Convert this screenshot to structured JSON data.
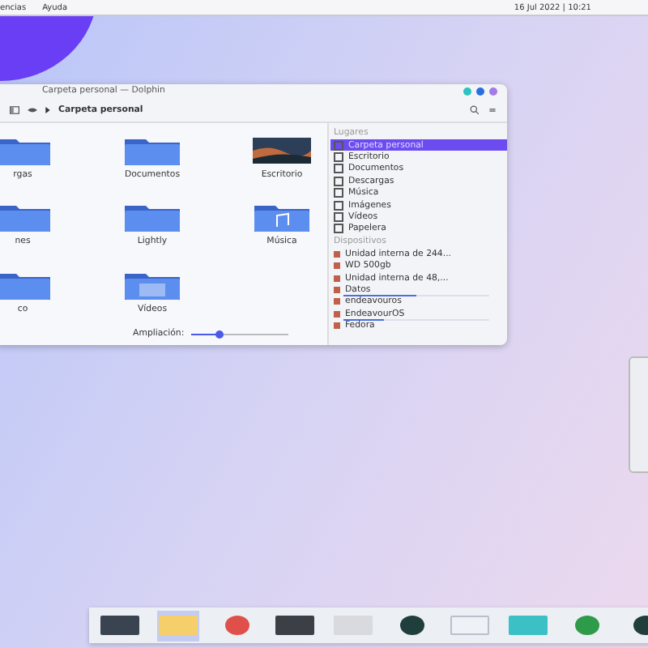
{
  "top_bar": {
    "menus": [
      "encias",
      "Ayuda"
    ],
    "clock": "16 Jul 2022 | 10:21"
  },
  "window": {
    "title": "Carpeta personal — Dolphin",
    "breadcrumb": "Carpeta personal",
    "files": [
      {
        "name": "rgas",
        "kind": "folder"
      },
      {
        "name": "Documentos",
        "kind": "folder"
      },
      {
        "name": "Escritorio",
        "kind": "image"
      },
      {
        "name": "nes",
        "kind": "folder"
      },
      {
        "name": "Lightly",
        "kind": "folder"
      },
      {
        "name": "Música",
        "kind": "music"
      },
      {
        "name": "co",
        "kind": "folder"
      },
      {
        "name": "Vídeos",
        "kind": "video"
      }
    ],
    "zoom": {
      "label": "Ampliación:",
      "level": 0.3
    },
    "sidebar": {
      "places_heading": "Lugares",
      "places": [
        {
          "label": "Carpeta personal",
          "selected": true
        },
        {
          "label": "Escritorio",
          "selected": false
        },
        {
          "label": "Documentos",
          "selected": false
        },
        {
          "label": "Descargas",
          "selected": false
        },
        {
          "label": "Música",
          "selected": false
        },
        {
          "label": "Imágenes",
          "selected": false
        },
        {
          "label": "Vídeos",
          "selected": false
        },
        {
          "label": "Papelera",
          "selected": false
        }
      ],
      "devices_heading": "Dispositivos",
      "devices": [
        {
          "label": "Unidad interna de 244..."
        },
        {
          "label": "WD 500gb"
        },
        {
          "label": "Unidad interna de 48,..."
        },
        {
          "label": "Datos",
          "level": 0.5
        },
        {
          "label": "endeavouros"
        },
        {
          "label": "EndeavourOS",
          "level": 0.28
        },
        {
          "label": "Fedora"
        }
      ]
    }
  },
  "dock": [
    {
      "kind": "terminal",
      "selected": false
    },
    {
      "kind": "folder",
      "selected": true
    },
    {
      "kind": "red",
      "selected": false
    },
    {
      "kind": "mountain",
      "selected": false
    },
    {
      "kind": "image",
      "selected": false
    },
    {
      "kind": "dark",
      "selected": false
    },
    {
      "kind": "doc",
      "selected": false
    },
    {
      "kind": "teal",
      "selected": false
    },
    {
      "kind": "green",
      "selected": false
    },
    {
      "kind": "dark",
      "selected": false
    }
  ]
}
